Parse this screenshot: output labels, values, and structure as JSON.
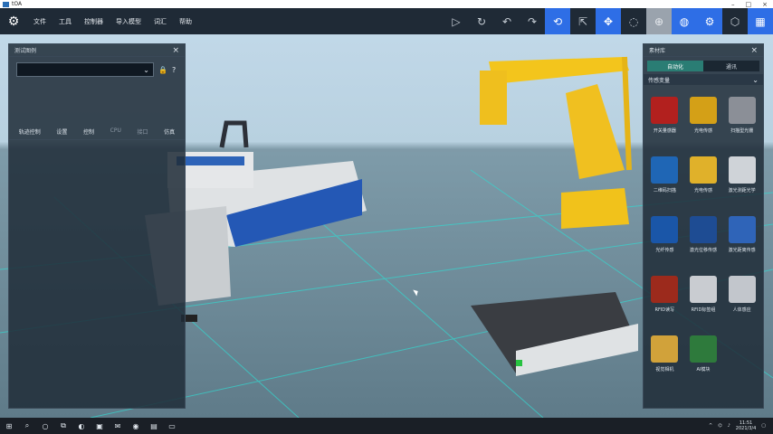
{
  "window": {
    "title": "tOA"
  },
  "menu": [
    "文件",
    "工具",
    "控制器",
    "导入模型",
    "词汇",
    "帮助"
  ],
  "toolbar": {
    "icons": [
      "play-icon",
      "refresh-icon",
      "undo-icon",
      "redo-icon",
      "rotate-view-icon",
      "select-icon",
      "move-icon",
      "rotate-icon",
      "target-icon",
      "globe-icon",
      "settings-icon",
      "cube-icon",
      "grid-icon"
    ]
  },
  "left_panel": {
    "title": "测试图例",
    "close": "×",
    "select_value": "",
    "select_arrow": "⌄",
    "tabs": [
      "轨迹控制",
      "设置",
      "控制",
      "CPU",
      "接口",
      "仿真"
    ]
  },
  "right_panel": {
    "title": "素材库",
    "close": "×",
    "segments": [
      "自动化",
      "通讯"
    ],
    "category": "传感变量",
    "category_chevron": "⌄",
    "items": [
      {
        "label": "开关量感器",
        "color": "#b2201e"
      },
      {
        "label": "光电传感",
        "color": "#d4a017"
      },
      {
        "label": "扫描型光栅",
        "color": "#8b8f97"
      },
      {
        "label": "二维码扫描",
        "color": "#1f66b5"
      },
      {
        "label": "光电传感",
        "color": "#e0b12a"
      },
      {
        "label": "激光测距光学",
        "color": "#cfd3d8"
      },
      {
        "label": "光纤传感",
        "color": "#1a56a8"
      },
      {
        "label": "激光位移传感",
        "color": "#1e4c93"
      },
      {
        "label": "激光距离传感",
        "color": "#2f64b8"
      },
      {
        "label": "RFID读写",
        "color": "#9c2a1c"
      },
      {
        "label": "RFID标签组",
        "color": "#c9ccd1"
      },
      {
        "label": "人体感应",
        "color": "#c2c6cc"
      },
      {
        "label": "视觉相机",
        "color": "#d1a23a"
      },
      {
        "label": "AI模块",
        "color": "#2e7a3c"
      },
      {
        "label": "",
        "color": "#00000000"
      }
    ]
  },
  "taskbar": {
    "time": "11:51",
    "date": "2021/3/4"
  }
}
